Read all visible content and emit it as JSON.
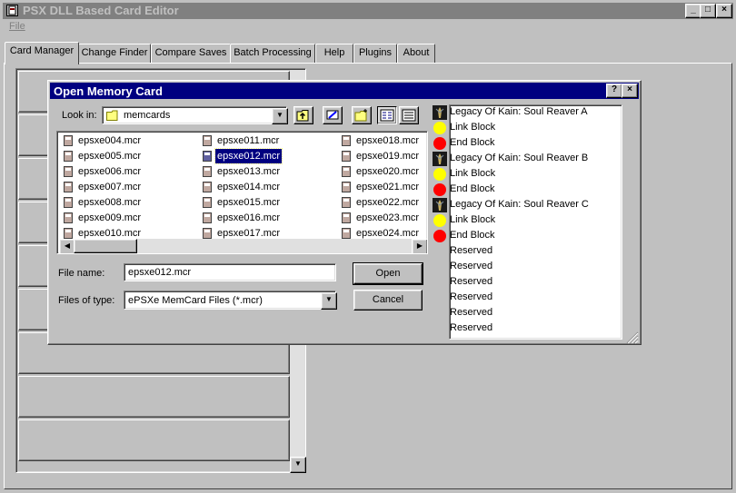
{
  "app": {
    "title": "PSX DLL Based Card Editor",
    "menu": [
      "File"
    ],
    "window_buttons": [
      "_",
      "□",
      "×"
    ]
  },
  "tabs": [
    {
      "label": "Card Manager",
      "active": true
    },
    {
      "label": "Change Finder"
    },
    {
      "label": "Compare Saves"
    },
    {
      "label": "Batch Processing"
    },
    {
      "label": "Help"
    },
    {
      "label": "Plugins"
    },
    {
      "label": "About"
    }
  ],
  "dialog": {
    "title": "Open Memory Card",
    "title_buttons": [
      "?",
      "×"
    ],
    "look_in_label": "Look in:",
    "look_in_value": "memcards",
    "files": [
      "epsxe004.mcr",
      "epsxe005.mcr",
      "epsxe006.mcr",
      "epsxe007.mcr",
      "epsxe008.mcr",
      "epsxe009.mcr",
      "epsxe010.mcr",
      "epsxe011.mcr",
      "epsxe012.mcr",
      "epsxe013.mcr",
      "epsxe014.mcr",
      "epsxe015.mcr",
      "epsxe016.mcr",
      "epsxe017.mcr",
      "epsxe018.mcr",
      "epsxe019.mcr",
      "epsxe020.mcr",
      "epsxe021.mcr",
      "epsxe022.mcr",
      "epsxe023.mcr",
      "epsxe024.mcr"
    ],
    "selected_file": "epsxe012.mcr",
    "file_name_label": "File name:",
    "file_name_value": "epsxe012.mcr",
    "files_of_type_label": "Files of type:",
    "files_of_type_value": "ePSXe MemCard Files (*.mcr)",
    "open_button": "Open",
    "cancel_button": "Cancel"
  },
  "blocks": [
    {
      "label": "Legacy Of Kain: Soul Reaver A",
      "icon": "game-icon"
    },
    {
      "label": "Link Block",
      "icon": "yellow-dot-icon"
    },
    {
      "label": "End Block",
      "icon": "red-dot-icon"
    },
    {
      "label": "Legacy Of Kain: Soul Reaver B",
      "icon": "game-icon"
    },
    {
      "label": "Link Block",
      "icon": "yellow-dot-icon"
    },
    {
      "label": "End Block",
      "icon": "red-dot-icon"
    },
    {
      "label": "Legacy Of Kain: Soul Reaver C",
      "icon": "game-icon"
    },
    {
      "label": "Link Block",
      "icon": "yellow-dot-icon"
    },
    {
      "label": "End Block",
      "icon": "red-dot-icon"
    },
    {
      "label": "Reserved",
      "icon": ""
    },
    {
      "label": "Reserved",
      "icon": ""
    },
    {
      "label": "Reserved",
      "icon": ""
    },
    {
      "label": "Reserved",
      "icon": ""
    },
    {
      "label": "Reserved",
      "icon": ""
    },
    {
      "label": "Reserved",
      "icon": ""
    }
  ],
  "colors": {
    "face": "#c0c0c0",
    "active_title": "#000080",
    "inactive_title": "#808080",
    "link_block": "#ffff00",
    "end_block": "#ff0000"
  }
}
